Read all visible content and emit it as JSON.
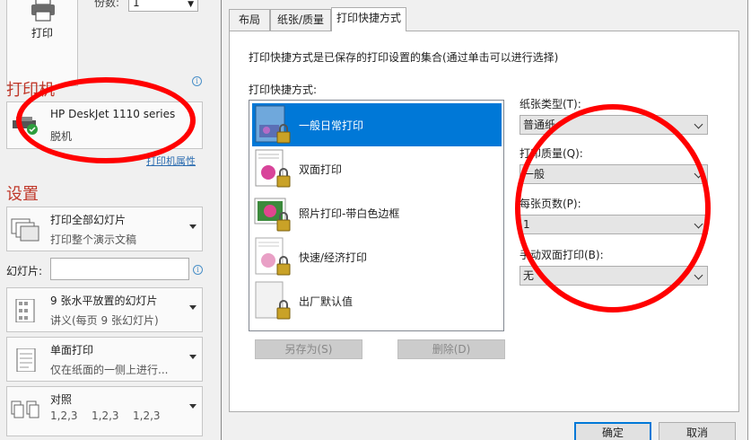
{
  "left_panel": {
    "print_button_label": "打印",
    "copies_label": "份数:",
    "copies_value": "1",
    "printer_section_title": "打印机",
    "printer_name": "HP DeskJet 1110 series",
    "printer_status": "脱机",
    "printer_properties_link": "打印机属性",
    "settings_section_title": "设置",
    "print_range": {
      "title": "打印全部幻灯片",
      "subtitle": "打印整个演示文稿"
    },
    "slides_label": "幻灯片:",
    "slides_value": "",
    "layout": {
      "title": "9 张水平放置的幻灯片",
      "subtitle": "讲义(每页 9 张幻灯片)"
    },
    "sides": {
      "title": "单面打印",
      "subtitle": "仅在纸面的一侧上进行..."
    },
    "collate": {
      "title": "对照",
      "nums": [
        "1,2,3",
        "1,2,3",
        "1,2,3"
      ]
    }
  },
  "dialog": {
    "tabs": [
      {
        "label": "布局"
      },
      {
        "label": "纸张/质量"
      },
      {
        "label": "打印快捷方式"
      }
    ],
    "active_tab": "打印快捷方式",
    "description": "打印快捷方式是已保存的打印设置的集合(通过单击可以进行选择)",
    "shortcuts_label": "打印快捷方式:",
    "shortcuts": [
      {
        "label": "一般日常打印",
        "selected": true
      },
      {
        "label": "双面打印",
        "selected": false
      },
      {
        "label": "照片打印-带白色边框",
        "selected": false
      },
      {
        "label": "快速/经济打印",
        "selected": false
      },
      {
        "label": "出厂默认值",
        "selected": false
      }
    ],
    "save_as_button": "另存为(S)",
    "delete_button": "删除(D)",
    "fields": {
      "paper_type": {
        "label": "纸张类型(T):",
        "value": "普通纸"
      },
      "print_quality": {
        "label": "打印质量(Q):",
        "value": "一般"
      },
      "pages_per_sheet": {
        "label": "每张页数(P):",
        "value": "1"
      },
      "manual_duplex": {
        "label": "手动双面打印(B):",
        "value": "无"
      }
    },
    "ok_button": "确定",
    "cancel_button": "取消"
  },
  "colors": {
    "accent": "#0078d7",
    "section_title": "#c0392b",
    "annotation": "#ff0000"
  }
}
